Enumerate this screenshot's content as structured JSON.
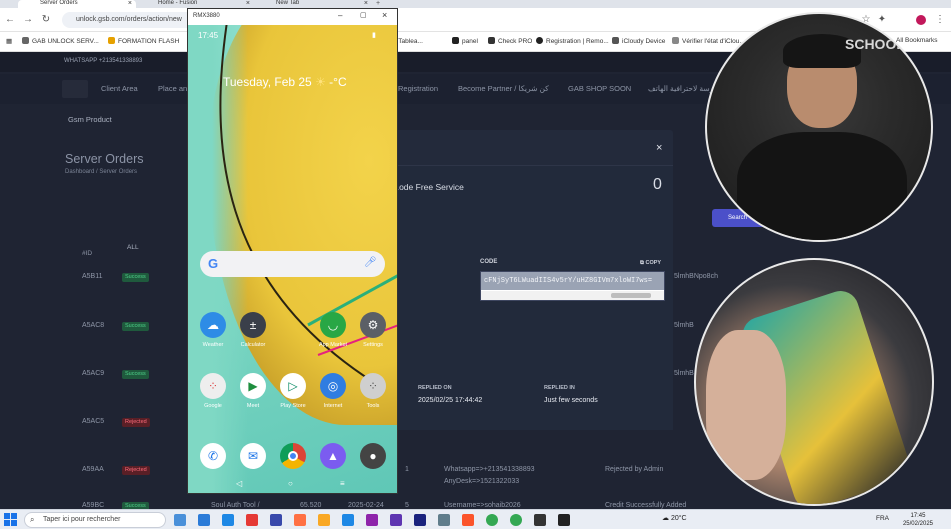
{
  "browser": {
    "tabs": [
      {
        "label": "Server Orders",
        "active": true
      },
      {
        "label": "Home - Fusion",
        "active": false
      },
      {
        "label": "New Tab",
        "active": false
      }
    ],
    "url": "unlock.gsb.com/orders/action/new",
    "bookmarks": [
      "GAB UNLOCK SERV...",
      "FORMATION FLASH",
      "Client Tablea...",
      "panel",
      "Check PRO",
      "Registration | Remo...",
      "iCloudy Device",
      "Vérifier l'état d'iClou...",
      "All Bookmarks"
    ]
  },
  "site": {
    "topinfo": "WHATSAPP +213541338893",
    "nav": [
      "Client Area",
      "Place an...",
      "Registration",
      "Become Partner / كن شريكا",
      "GAB SHOP SOON",
      "مدرسة لاحترافية الهاتف"
    ],
    "gsm_product": "Gsm Product",
    "page_title": "Server Orders",
    "breadcrumb": "Dashboard / Server Orders",
    "search_button": "Search",
    "filter_all": "ALL",
    "col_id": "#ID",
    "rows": [
      {
        "id": "A5B11",
        "status": "Success",
        "side": "5lmhBNpo8ch"
      },
      {
        "id": "A5AC8",
        "status": "Success",
        "side": "5lmhB"
      },
      {
        "id": "A5AC9",
        "status": "Success",
        "side": "5lmhB"
      },
      {
        "id": "A5AC5",
        "status": "Rejected",
        "side": ""
      },
      {
        "id": "A59AA",
        "status": "Rejected",
        "side": ""
      },
      {
        "id": "A59BC",
        "status": "Success",
        "side": ""
      }
    ],
    "row_a59aa": {
      "qty": "1",
      "line1": "Whatsapp=>+213541338893",
      "line2": "AnyDesk=>1521322033",
      "note": "Rejected by Admin"
    },
    "row_last": {
      "service": "Soul Auth Tool /",
      "price": "65.520",
      "date": "2025-02-24",
      "qty": "5",
      "user": "Username=>sohaib2026",
      "note": "Credit Successfully Added"
    }
  },
  "modal": {
    "title": "...ode Free Service",
    "count": "0",
    "code_label": "CODE",
    "copy_label": "COPY",
    "code_value": "cFNjSyT6LWuadIIS4v5rY/uHZ8GIVm7xloWI7ws=",
    "replied_on_label": "REPLIED ON",
    "replied_on_value": "2025/02/25 17:44:42",
    "replied_in_label": "REPLIED IN",
    "replied_in_value": "Just few seconds"
  },
  "phone": {
    "window_title": "RMX3880",
    "time": "17:45",
    "date": "Tuesday, Feb 25",
    "temp": "-°C",
    "apps_row1": [
      {
        "label": "Weather",
        "color": "#2e8ce6"
      },
      {
        "label": "Calculator",
        "color": "#3a3f4a"
      },
      {
        "label": "App Market",
        "color": "#28a745"
      },
      {
        "label": "Settings",
        "color": "#5b5f66"
      }
    ],
    "apps_row2": [
      {
        "label": "Google",
        "color": "#eeeeee"
      },
      {
        "label": "Meet",
        "color": "#ffffff"
      },
      {
        "label": "Play Store",
        "color": "#ffffff"
      },
      {
        "label": "Internet",
        "color": "#2f7de1"
      },
      {
        "label": "Tools",
        "color": "#cfcfcf"
      }
    ],
    "dock": [
      {
        "label": "Phone",
        "color": "#ffffff"
      },
      {
        "label": "Messages",
        "color": "#ffffff"
      },
      {
        "label": "Chrome",
        "color": "#ffffff"
      },
      {
        "label": "Gallery",
        "color": "#7b5cf0"
      },
      {
        "label": "Camera",
        "color": "#444444"
      }
    ]
  },
  "taskbar": {
    "search_placeholder": "Taper ici pour rechercher",
    "weather": "20°C",
    "lang": "FRA",
    "time": "17:45",
    "date": "25/02/2025"
  },
  "overlay": {
    "watermark": "SCHOOL"
  },
  "colors": {
    "accent": "#4b50c9",
    "success": "#4fd18a",
    "rejected": "#ff6b7b"
  }
}
